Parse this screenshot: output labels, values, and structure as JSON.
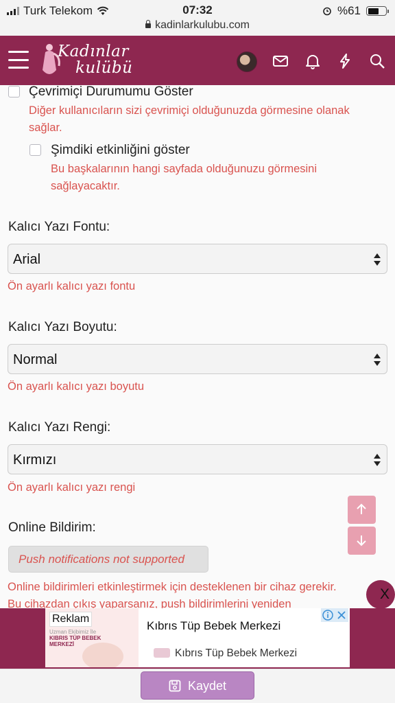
{
  "status_bar": {
    "carrier": "Turk Telekom",
    "time": "07:32",
    "battery": "%61",
    "url": "kadinlarkulubu.com"
  },
  "header": {
    "logo_line1": "Kadınlar",
    "logo_line2": "kulübü"
  },
  "options": {
    "online_status": {
      "label": "Çevrimiçi Durumumu Göster",
      "desc_line1": "Diğer kullanıcıların sizi çevrimiçi olduğunuzda görmesine olanak",
      "desc_line2": "sağlar."
    },
    "current_activity": {
      "label": "Şimdiki etkinliğini göster",
      "desc_line1": "Bu başkalarının hangi sayfada olduğunuzu görmesini",
      "desc_line2": "sağlayacaktır."
    }
  },
  "fields": {
    "font": {
      "label": "Kalıcı Yazı Fontu:",
      "value": "Arial",
      "hint": "Ön ayarlı kalıcı yazı fontu"
    },
    "size": {
      "label": "Kalıcı Yazı Boyutu:",
      "value": "Normal",
      "hint": "Ön ayarlı kalıcı yazı boyutu"
    },
    "color": {
      "label": "Kalıcı Yazı Rengi:",
      "value": "Kırmızı",
      "hint": "Ön ayarlı kalıcı yazı rengi"
    }
  },
  "online_notification": {
    "label": "Online Bildirim:",
    "button": "Push notifications not supported",
    "desc_line1": "Online bildirimleri etkinleştirmek için desteklenen bir cihaz gerekir.",
    "desc_line2": "Bu cihazdan çıkış yaparsanız, push bildirimlerini yeniden"
  },
  "ad": {
    "badge": "Reklam",
    "sub_line1": "Uzman Ekibimiz İle",
    "sub_line2": "KIBRIS TÜP BEBEK",
    "sub_line3": "MERKEZİ",
    "title": "Kıbrıs Tüp Bebek Merkezi",
    "brand": "Kıbrıs Tüp Bebek Merkezi",
    "close_label": "X"
  },
  "footer": {
    "save_label": "Kaydet"
  },
  "colors": {
    "brand": "#8e2750",
    "error_text": "#d9534f",
    "save_button": "#b986c3",
    "scroll_buttons": "#e8a0b0"
  }
}
